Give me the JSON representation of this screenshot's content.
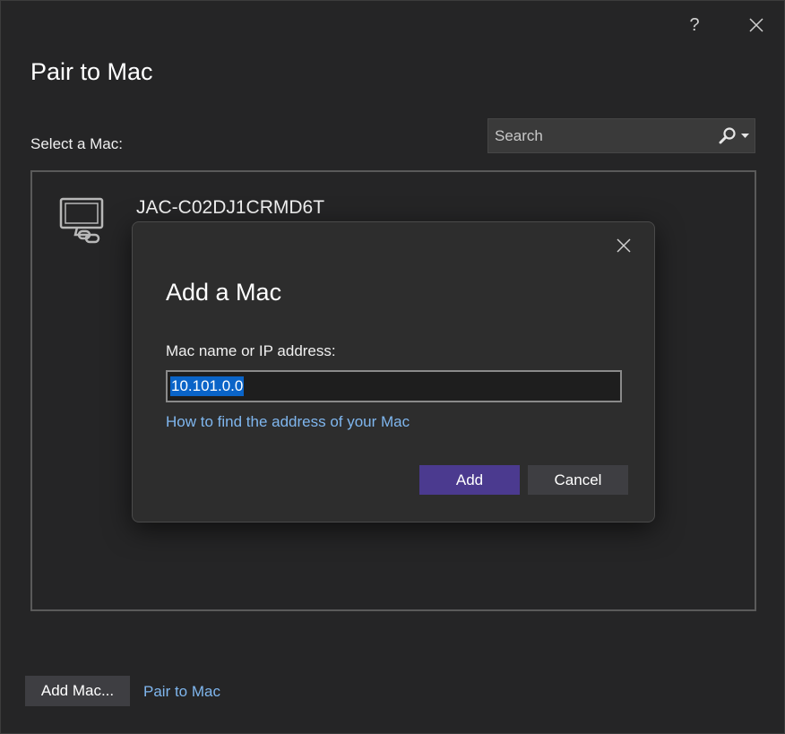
{
  "window": {
    "title": "Pair to Mac",
    "help_label": "?",
    "select_label": "Select a Mac:",
    "search": {
      "placeholder": "Search",
      "value": ""
    }
  },
  "mac_list": {
    "items": [
      {
        "name": "JAC-C02DJ1CRMD6T",
        "icon": "computer-link-icon"
      }
    ]
  },
  "modal": {
    "title": "Add a Mac",
    "field_label": "Mac name or IP address:",
    "field_value": "10.101.0.0",
    "help_link": "How to find the address of your Mac",
    "add_label": "Add",
    "cancel_label": "Cancel"
  },
  "footer": {
    "add_mac_label": "Add Mac...",
    "pair_link": "Pair to Mac"
  },
  "colors": {
    "background": "#252526",
    "accent_button": "#4b3a8f",
    "link": "#7fb6ee",
    "selection": "#0a64c8"
  }
}
